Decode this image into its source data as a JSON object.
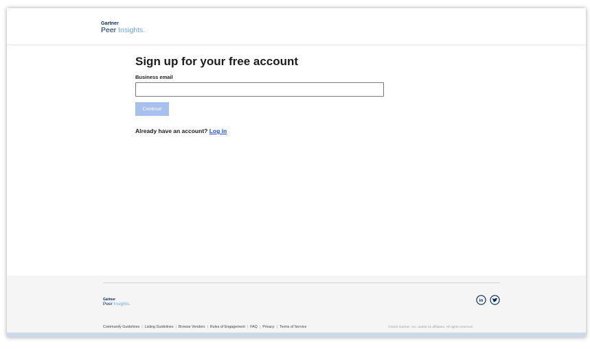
{
  "header": {
    "logo": {
      "brand": "Gartner",
      "product_part1": "Peer ",
      "product_part2": "Insights",
      "product_dot": "."
    }
  },
  "signup": {
    "title": "Sign up for your free account",
    "email_label": "Business email",
    "email_value": "",
    "email_placeholder": "",
    "continue_label": "Continue",
    "login_prompt": "Already have an account?",
    "login_link": "Log in"
  },
  "footer": {
    "logo": {
      "brand": "Gartner",
      "product_part1": "Peer ",
      "product_part2": "Insights",
      "product_dot": "."
    },
    "links": [
      "Community Guidelines",
      "Listing Guidelines",
      "Browse Vendors",
      "Rules of Engagement",
      "FAQ",
      "Privacy",
      "Terms of Service"
    ],
    "copyright": "©2023 Gartner, Inc. and/or its affiliates. All rights reserved.",
    "social": {
      "linkedin": "in"
    }
  },
  "colors": {
    "brand_navy": "#002856",
    "brand_light_blue": "#6fa8dc",
    "button_disabled": "#a8c0f0",
    "link_blue": "#1a49d6"
  },
  "icons": [
    "linkedin-icon",
    "twitter-icon"
  ]
}
